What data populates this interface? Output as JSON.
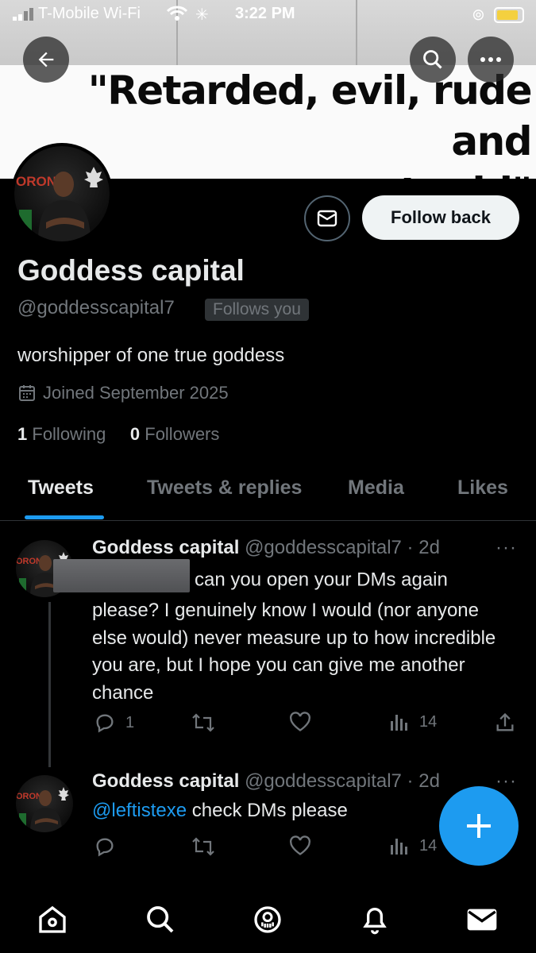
{
  "status_bar": {
    "carrier": "T-Mobile Wi-Fi",
    "time": "3:22 PM"
  },
  "banner": {
    "line1": "\"Retarded, evil, rude and",
    "line2": "stupid\""
  },
  "profile": {
    "avatar_text": "ORON",
    "follow_button_label": "Follow back",
    "display_name": "Goddess capital",
    "handle": "@goddesscapital7",
    "follows_you_badge": "Follows you",
    "bio": "worshipper of one true goddess",
    "joined": "Joined September 2025",
    "following_count": "1",
    "following_label": "Following",
    "followers_count": "0",
    "followers_label": "Followers"
  },
  "tabs": [
    {
      "label": "Tweets",
      "active": true
    },
    {
      "label": "Tweets & replies",
      "active": false
    },
    {
      "label": "Media",
      "active": false
    },
    {
      "label": "Likes",
      "active": false
    }
  ],
  "tweets": [
    {
      "name": "Goddess capital",
      "handle_time": "@goddesscapital7 · 2d",
      "text_line1": "can you open your DMs again",
      "text_rest": "please? I genuinely know I would (nor anyone else would) never measure up to how incredible you are, but I hope you can give me another chance",
      "replies": "1",
      "retweets": "",
      "likes": "",
      "views": "14"
    },
    {
      "name": "Goddess capital",
      "handle_time": "@goddesscapital7 · 2d",
      "mention": "@leftistexe",
      "text": "check DMs please",
      "replies": "",
      "retweets": "",
      "likes": "",
      "views": "14"
    }
  ],
  "colors": {
    "accent": "#1d9bf0",
    "background": "#000000",
    "secondary_text": "#71767b"
  },
  "icons": {
    "back": "arrow-left-icon",
    "search": "search-icon",
    "more": "more-icon",
    "mail": "mail-icon",
    "compose": "plus-icon"
  }
}
